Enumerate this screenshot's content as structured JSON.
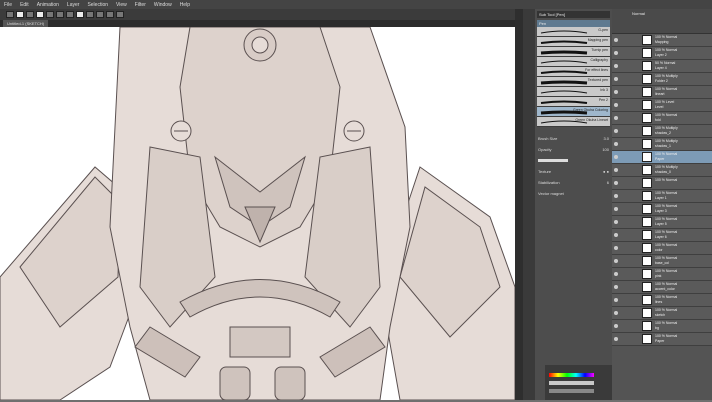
{
  "menu": [
    "File",
    "Edit",
    "Animation",
    "Layer",
    "Selection",
    "View",
    "Filter",
    "Window",
    "Help"
  ],
  "doc_tab": "Untitled-1 (SKETCH)",
  "brush_panel": {
    "header": "Sub Tool [Pen]",
    "tab": "Pen",
    "brushes": [
      {
        "label": "G-pen"
      },
      {
        "label": "Mapping pen"
      },
      {
        "label": "Turnip pen"
      },
      {
        "label": "Calligraphy"
      },
      {
        "label": "For effect lines"
      },
      {
        "label": "Textured pen"
      },
      {
        "label": "Ink 3"
      },
      {
        "label": "Pen 2"
      },
      {
        "label": "Green Okuha Coloring"
      },
      {
        "label": "Green Okuha Lineart"
      }
    ],
    "selected_brush": "Green Okuha Coloring",
    "props": {
      "brush_size_label": "Brush Size",
      "brush_size_value": "3.0",
      "opacity_label": "Opacity",
      "opacity_value": "100",
      "texture_label": "Texture",
      "stabilization_label": "Stabilization",
      "stabilization_value": "6",
      "vector_label": "Vector magnet"
    }
  },
  "layer_panel": {
    "header_mode": "Normal",
    "layers": [
      {
        "info": "100 % Normal",
        "name": "Mapping",
        "selected": false
      },
      {
        "info": "100 % Normal",
        "name": "Layer 2",
        "selected": false
      },
      {
        "info": "50 % Normal",
        "name": "Layer 4",
        "selected": false
      },
      {
        "info": "100 % Multiply",
        "name": "Folder 2",
        "selected": false
      },
      {
        "info": "100 % Normal",
        "name": "lineart",
        "selected": false
      },
      {
        "info": "100 % Level",
        "name": "Level",
        "selected": false
      },
      {
        "info": "100 % Normal",
        "name": "fold",
        "selected": false
      },
      {
        "info": "100 % Multiply",
        "name": "shadow_2",
        "selected": false
      },
      {
        "info": "100 % Multiply",
        "name": "shadow_1",
        "selected": false
      },
      {
        "info": "100 % Normal",
        "name": "Paper",
        "selected": true
      },
      {
        "info": "100 % Multiply",
        "name": "shadow_0",
        "selected": false
      },
      {
        "info": "100 % Normal",
        "name": "",
        "selected": false
      },
      {
        "info": "100 % Normal",
        "name": "Layer 1",
        "selected": false
      },
      {
        "info": "100 % Normal",
        "name": "Layer 3",
        "selected": false
      },
      {
        "info": "100 % Normal",
        "name": "Layer 5",
        "selected": false
      },
      {
        "info": "100 % Normal",
        "name": "Layer 6",
        "selected": false
      },
      {
        "info": "100 % Normal",
        "name": "color",
        "selected": false
      },
      {
        "info": "100 % Normal",
        "name": "base_col",
        "selected": false
      },
      {
        "info": "100 % Normal",
        "name": "pink",
        "selected": false
      },
      {
        "info": "100 % Normal",
        "name": "accent_color",
        "selected": false
      },
      {
        "info": "100 % Normal",
        "name": "lines",
        "selected": false
      },
      {
        "info": "100 % Normal",
        "name": "sketch",
        "selected": false
      },
      {
        "info": "100 % Normal",
        "name": "bg",
        "selected": false
      },
      {
        "info": "100 % Normal",
        "name": "Paper",
        "selected": false
      }
    ]
  },
  "colors": {
    "accent": "#7d9bb6",
    "canvas_fill": "#e6dcd7",
    "line": "#5a5050"
  }
}
